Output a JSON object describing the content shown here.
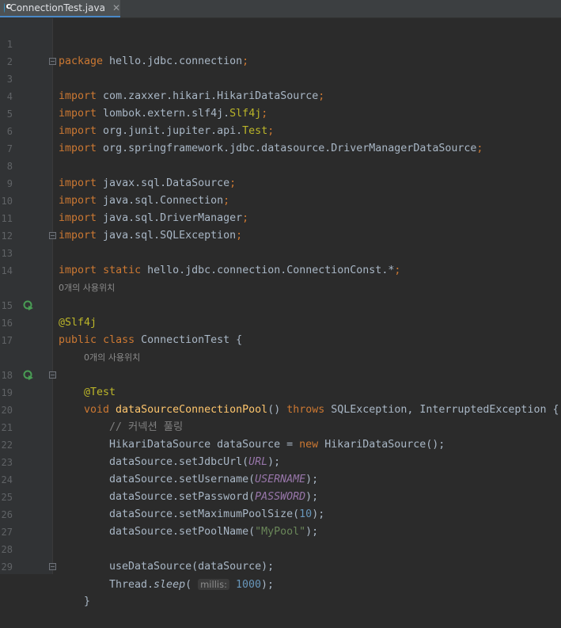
{
  "tab": {
    "filename": "ConnectionTest.java",
    "close": "✕"
  },
  "lines": [
    {
      "n": "1",
      "kind": "code",
      "id": "package"
    },
    {
      "n": "2",
      "kind": "blank"
    },
    {
      "n": "3",
      "kind": "code",
      "id": "imp1"
    },
    {
      "n": "4",
      "kind": "code",
      "id": "imp2"
    },
    {
      "n": "5",
      "kind": "code",
      "id": "imp3"
    },
    {
      "n": "6",
      "kind": "code",
      "id": "imp4"
    },
    {
      "n": "7",
      "kind": "blank"
    },
    {
      "n": "8",
      "kind": "code",
      "id": "imp5"
    },
    {
      "n": "9",
      "kind": "code",
      "id": "imp6"
    },
    {
      "n": "10",
      "kind": "code",
      "id": "imp7"
    },
    {
      "n": "11",
      "kind": "code",
      "id": "imp8"
    },
    {
      "n": "12",
      "kind": "blank"
    },
    {
      "n": "13",
      "kind": "code",
      "id": "imp9"
    },
    {
      "n": "14",
      "kind": "blank"
    },
    {
      "n": "15",
      "kind": "code",
      "id": "annSlf4j"
    },
    {
      "n": "16",
      "kind": "code",
      "id": "classDecl"
    },
    {
      "n": "17",
      "kind": "blank"
    },
    {
      "n": "18",
      "kind": "code",
      "id": "annTest"
    },
    {
      "n": "19",
      "kind": "code",
      "id": "methodDecl"
    },
    {
      "n": "20",
      "kind": "code",
      "id": "comment"
    },
    {
      "n": "21",
      "kind": "code",
      "id": "newDs"
    },
    {
      "n": "22",
      "kind": "code",
      "id": "setUrl"
    },
    {
      "n": "23",
      "kind": "code",
      "id": "setUser"
    },
    {
      "n": "24",
      "kind": "code",
      "id": "setPass"
    },
    {
      "n": "25",
      "kind": "code",
      "id": "setMax"
    },
    {
      "n": "26",
      "kind": "code",
      "id": "setPool"
    },
    {
      "n": "27",
      "kind": "blank"
    },
    {
      "n": "28",
      "kind": "code",
      "id": "useDs"
    },
    {
      "n": "29",
      "kind": "code",
      "id": "sleep"
    },
    {
      "n": "",
      "kind": "code",
      "id": "closeBrace"
    }
  ],
  "usage_hint": "0개의 사용위치",
  "code": {
    "kw_package": "package",
    "package_name": " hello.jdbc.connection",
    "kw_import": "import",
    "imp1": " com.zaxxer.hikari.HikariDataSource",
    "imp2_a": " lombok.extern.slf4j.",
    "imp2_b": "Slf4j",
    "imp3_a": " org.junit.jupiter.api.",
    "imp3_b": "Test",
    "imp4": " org.springframework.jdbc.datasource.DriverManagerDataSource",
    "imp5": " javax.sql.DataSource",
    "imp6": " java.sql.Connection",
    "imp7": " java.sql.DriverManager",
    "imp8": " java.sql.SQLException",
    "kw_static": "static",
    "imp9": " hello.jdbc.connection.ConnectionConst.*",
    "semi": ";",
    "ann_slf4j": "@Slf4j",
    "kw_public": "public",
    "kw_class": "class",
    "class_name": " ConnectionTest {",
    "ann_test": "@Test",
    "kw_void": "void",
    "method_name": "dataSourceConnectionPool",
    "method_paren": "() ",
    "kw_throws": "throws",
    "method_exc": " SQLException, InterruptedException {",
    "comment": "// 커넥션 풀링",
    "new_ds_a": "HikariDataSource dataSource = ",
    "kw_new": "new",
    "new_ds_b": " HikariDataSource();",
    "set_url_a": "dataSource.setJdbcUrl(",
    "const_url": "URL",
    "close_call": ");",
    "set_user_a": "dataSource.setUsername(",
    "const_user": "USERNAME",
    "set_pass_a": "dataSource.setPassword(",
    "const_pass": "PASSWORD",
    "set_max_a": "dataSource.setMaximumPoolSize(",
    "num_10": "10",
    "set_pool_a": "dataSource.setPoolName(",
    "str_pool": "\"MyPool\"",
    "use_ds": "useDataSource(dataSource);",
    "sleep_a": "Thread.",
    "sleep_fn": "sleep",
    "sleep_b": "(",
    "param_hint": "millis:",
    "num_1000": "1000",
    "close_brace": "}"
  },
  "colors": {
    "background": "#2b2b2b",
    "keyword": "#cc7832",
    "annotation": "#bbb529",
    "function": "#ffc66d",
    "constant": "#9876aa",
    "number": "#6897bb",
    "string": "#6a8759",
    "comment": "#808080",
    "text": "#a9b7c6"
  }
}
